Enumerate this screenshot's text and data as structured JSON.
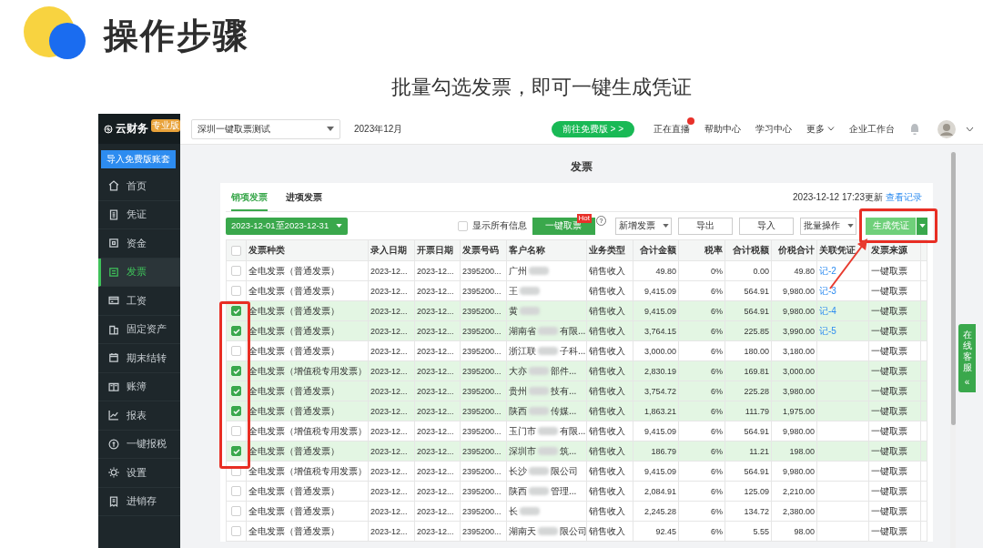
{
  "slide": {
    "title": "操作步骤",
    "subtitle": "批量勾选发票，即可一键生成凭证"
  },
  "app": {
    "sidebar": {
      "logo": "云财务",
      "edition_badge": "专业版",
      "import_button": "导入免费版账套",
      "items": [
        {
          "label": "首页",
          "selected": false
        },
        {
          "label": "凭证",
          "selected": false
        },
        {
          "label": "资金",
          "selected": false
        },
        {
          "label": "发票",
          "selected": true
        },
        {
          "label": "工资",
          "selected": false
        },
        {
          "label": "固定资产",
          "selected": false
        },
        {
          "label": "期末结转",
          "selected": false
        },
        {
          "label": "账簿",
          "selected": false
        },
        {
          "label": "报表",
          "selected": false
        },
        {
          "label": "一键报税",
          "selected": false
        },
        {
          "label": "设置",
          "selected": false
        },
        {
          "label": "进销存",
          "selected": false
        }
      ]
    },
    "topbar": {
      "company": "深圳一键取票测试",
      "period": "2023年12月",
      "promo_button": "前往免费版 > >",
      "links": [
        {
          "label": "正在直播",
          "badge": true,
          "dropdown": false
        },
        {
          "label": "帮助中心",
          "badge": false,
          "dropdown": false
        },
        {
          "label": "学习中心",
          "badge": false,
          "dropdown": false
        },
        {
          "label": "更多",
          "badge": false,
          "dropdown": true
        },
        {
          "label": "企业工作台",
          "badge": false,
          "dropdown": false
        }
      ]
    },
    "page_title": "发票",
    "tabs": [
      {
        "label": "销项发票",
        "selected": true
      },
      {
        "label": "进项发票",
        "selected": false
      }
    ],
    "updated": "2023-12-12 17:23更新",
    "history_link": "查看记录",
    "toolbar": {
      "date_range": "2023-12-01至2023-12-31",
      "show_all": {
        "label": "显示所有信息",
        "checked": false
      },
      "fetch_button": "一键取票",
      "fetch_badge": "Hot",
      "help": "?",
      "buttons": [
        {
          "label": "新增发票",
          "kind": "dropdown"
        },
        {
          "label": "导出",
          "kind": "plain"
        },
        {
          "label": "导入",
          "kind": "plain"
        },
        {
          "label": "批量操作",
          "kind": "dropdown"
        },
        {
          "label": "生成凭证",
          "kind": "primary"
        }
      ]
    },
    "table": {
      "all_checked": false,
      "columns": [
        "发票种类",
        "录入日期",
        "开票日期",
        "发票号码",
        "客户名称",
        "业务类型",
        "合计金额",
        "税率",
        "合计税额",
        "价税合计",
        "关联凭证",
        "发票来源"
      ],
      "rows": [
        {
          "checked": false,
          "type": "全电发票（普通发票）",
          "entry_date": "2023-12...",
          "issue_date": "2023-12...",
          "number": "2395200...",
          "customer_start": "广州",
          "customer_end": "",
          "business": "销售收入",
          "amount": "49.80",
          "rate": "0%",
          "tax": "0.00",
          "total": "49.80",
          "voucher": "记-2",
          "source": "一键取票"
        },
        {
          "checked": false,
          "type": "全电发票（普通发票）",
          "entry_date": "2023-12...",
          "issue_date": "2023-12...",
          "number": "2395200...",
          "customer_start": "王",
          "customer_end": "",
          "business": "销售收入",
          "amount": "9,415.09",
          "rate": "6%",
          "tax": "564.91",
          "total": "9,980.00",
          "voucher": "记-3",
          "source": "一键取票"
        },
        {
          "checked": true,
          "type": "全电发票（普通发票）",
          "entry_date": "2023-12...",
          "issue_date": "2023-12...",
          "number": "2395200...",
          "customer_start": "黄",
          "customer_end": "",
          "business": "销售收入",
          "amount": "9,415.09",
          "rate": "6%",
          "tax": "564.91",
          "total": "9,980.00",
          "voucher": "记-4",
          "source": "一键取票"
        },
        {
          "checked": true,
          "type": "全电发票（普通发票）",
          "entry_date": "2023-12...",
          "issue_date": "2023-12...",
          "number": "2395200...",
          "customer_start": "湖南省",
          "customer_end": "有限...",
          "business": "销售收入",
          "amount": "3,764.15",
          "rate": "6%",
          "tax": "225.85",
          "total": "3,990.00",
          "voucher": "记-5",
          "source": "一键取票"
        },
        {
          "checked": false,
          "type": "全电发票（普通发票）",
          "entry_date": "2023-12...",
          "issue_date": "2023-12...",
          "number": "2395200...",
          "customer_start": "浙江联",
          "customer_end": "子科...",
          "business": "销售收入",
          "amount": "3,000.00",
          "rate": "6%",
          "tax": "180.00",
          "total": "3,180.00",
          "source": "一键取票"
        },
        {
          "checked": true,
          "type": "全电发票（增值税专用发票）",
          "entry_date": "2023-12...",
          "issue_date": "2023-12...",
          "number": "2395200...",
          "customer_start": "大亦",
          "customer_end": "部件...",
          "business": "销售收入",
          "amount": "2,830.19",
          "rate": "6%",
          "tax": "169.81",
          "total": "3,000.00",
          "source": "一键取票"
        },
        {
          "checked": true,
          "type": "全电发票（普通发票）",
          "entry_date": "2023-12...",
          "issue_date": "2023-12...",
          "number": "2395200...",
          "customer_start": "贵州",
          "customer_end": "技有...",
          "business": "销售收入",
          "amount": "3,754.72",
          "rate": "6%",
          "tax": "225.28",
          "total": "3,980.00",
          "source": "一键取票"
        },
        {
          "checked": true,
          "type": "全电发票（普通发票）",
          "entry_date": "2023-12...",
          "issue_date": "2023-12...",
          "number": "2395200...",
          "customer_start": "陕西",
          "customer_end": "传媒...",
          "business": "销售收入",
          "amount": "1,863.21",
          "rate": "6%",
          "tax": "111.79",
          "total": "1,975.00",
          "source": "一键取票"
        },
        {
          "checked": false,
          "type": "全电发票（增值税专用发票）",
          "entry_date": "2023-12...",
          "issue_date": "2023-12...",
          "number": "2395200...",
          "customer_start": "玉门市",
          "customer_end": "有限...",
          "business": "销售收入",
          "amount": "9,415.09",
          "rate": "6%",
          "tax": "564.91",
          "total": "9,980.00",
          "source": "一键取票"
        },
        {
          "checked": true,
          "type": "全电发票（普通发票）",
          "entry_date": "2023-12...",
          "issue_date": "2023-12...",
          "number": "2395200...",
          "customer_start": "深圳市",
          "customer_end": "筑...",
          "business": "销售收入",
          "amount": "186.79",
          "rate": "6%",
          "tax": "11.21",
          "total": "198.00",
          "source": "一键取票"
        },
        {
          "checked": false,
          "type": "全电发票（增值税专用发票）",
          "entry_date": "2023-12...",
          "issue_date": "2023-12...",
          "number": "2395200...",
          "customer_start": "长沙",
          "customer_end": "限公司",
          "business": "销售收入",
          "amount": "9,415.09",
          "rate": "6%",
          "tax": "564.91",
          "total": "9,980.00",
          "source": "一键取票"
        },
        {
          "checked": false,
          "type": "全电发票（普通发票）",
          "entry_date": "2023-12...",
          "issue_date": "2023-12...",
          "number": "2395200...",
          "customer_start": "陕西",
          "customer_end": "管理...",
          "business": "销售收入",
          "amount": "2,084.91",
          "rate": "6%",
          "tax": "125.09",
          "total": "2,210.00",
          "source": "一键取票"
        },
        {
          "checked": false,
          "type": "全电发票（普通发票）",
          "entry_date": "2023-12...",
          "issue_date": "2023-12...",
          "number": "2395200...",
          "customer_start": "长",
          "customer_end": "",
          "business": "销售收入",
          "amount": "2,245.28",
          "rate": "6%",
          "tax": "134.72",
          "total": "2,380.00",
          "source": "一键取票"
        },
        {
          "checked": false,
          "type": "全电发票（普通发票）",
          "entry_date": "2023-12...",
          "issue_date": "2023-12...",
          "number": "2395200...",
          "customer_start": "湖南天",
          "customer_end": "限公司",
          "business": "销售收入",
          "amount": "92.45",
          "rate": "6%",
          "tax": "5.55",
          "total": "98.00",
          "source": "一键取票"
        }
      ]
    },
    "service_tab": {
      "label": "在线客服",
      "arrow": "«"
    }
  }
}
